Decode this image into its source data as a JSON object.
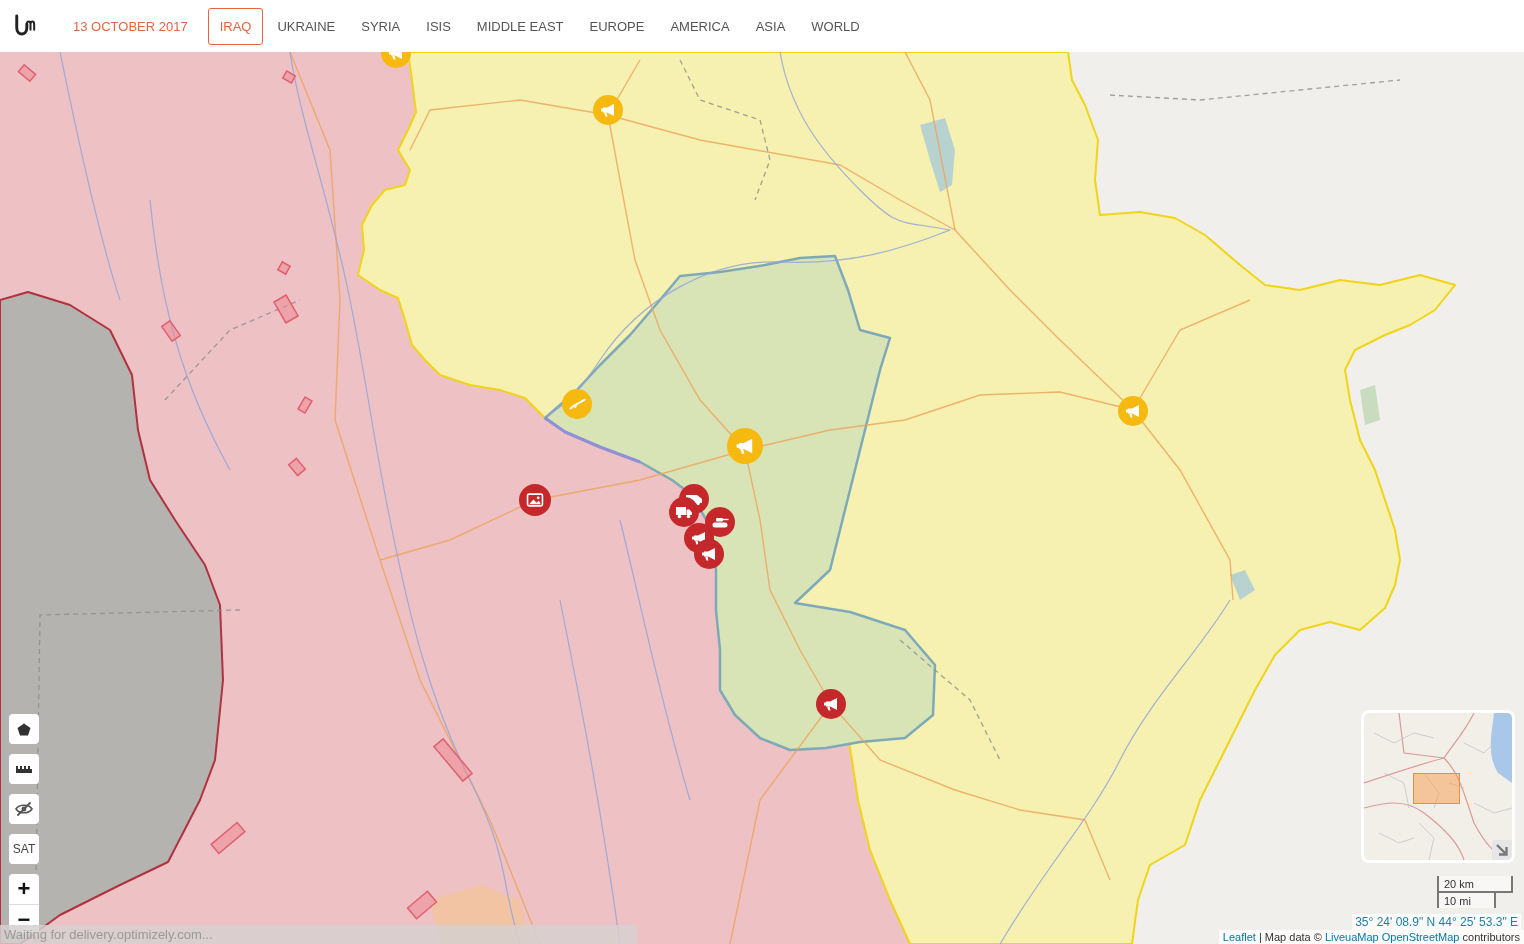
{
  "header": {
    "date": "13 OCTOBER 2017",
    "tabs": [
      {
        "label": "IRAQ",
        "selected": true
      },
      {
        "label": "UKRAINE",
        "selected": false
      },
      {
        "label": "SYRIA",
        "selected": false
      },
      {
        "label": "ISIS",
        "selected": false
      },
      {
        "label": "MIDDLE EAST",
        "selected": false
      },
      {
        "label": "EUROPE",
        "selected": false
      },
      {
        "label": "AMERICA",
        "selected": false
      },
      {
        "label": "ASIA",
        "selected": false
      },
      {
        "label": "WORLD",
        "selected": false
      }
    ]
  },
  "map": {
    "zones": [
      {
        "color": "#eec1c4"
      },
      {
        "color": "#f6f1b0"
      },
      {
        "color": "#d8e4b5"
      },
      {
        "color": "#b4b3b0"
      }
    ],
    "markers": [
      {
        "kind": "megaphone",
        "color": "#f6b90f"
      },
      {
        "kind": "megaphone",
        "color": "#f6b90f"
      },
      {
        "kind": "rifle",
        "color": "#f6b90f"
      },
      {
        "kind": "megaphone",
        "color": "#f6b90f"
      },
      {
        "kind": "megaphone",
        "color": "#f6b90f"
      },
      {
        "kind": "photo",
        "color": "#c5282a"
      },
      {
        "kind": "van",
        "color": "#c5282a"
      },
      {
        "kind": "truck",
        "color": "#c5282a"
      },
      {
        "kind": "tank",
        "color": "#c5282a"
      },
      {
        "kind": "megaphone",
        "color": "#c5282a"
      },
      {
        "kind": "megaphone",
        "color": "#c5282a"
      },
      {
        "kind": "megaphone",
        "color": "#c5282a"
      }
    ],
    "tools": [
      {
        "kind": "polygon"
      },
      {
        "kind": "ruler"
      },
      {
        "kind": "hide"
      },
      {
        "kind": "text",
        "label": "SAT"
      }
    ],
    "zoom": {
      "in": "+",
      "out": "−"
    },
    "scale": {
      "metric": "20 km",
      "imperial": "10 mi"
    },
    "coordinates": "35° 24' 08.9\" N 44° 25' 53.3\" E",
    "attribution": [
      {
        "kind": "link",
        "text": "Leaflet"
      },
      {
        "kind": "text",
        "text": "| Map data ©"
      },
      {
        "kind": "link",
        "text": "LiveuaMap"
      },
      {
        "kind": "link",
        "text": "OpenStreetMap"
      },
      {
        "kind": "text",
        "text": "contributors"
      }
    ]
  },
  "status": "Waiting for delivery.optimizely.com..."
}
